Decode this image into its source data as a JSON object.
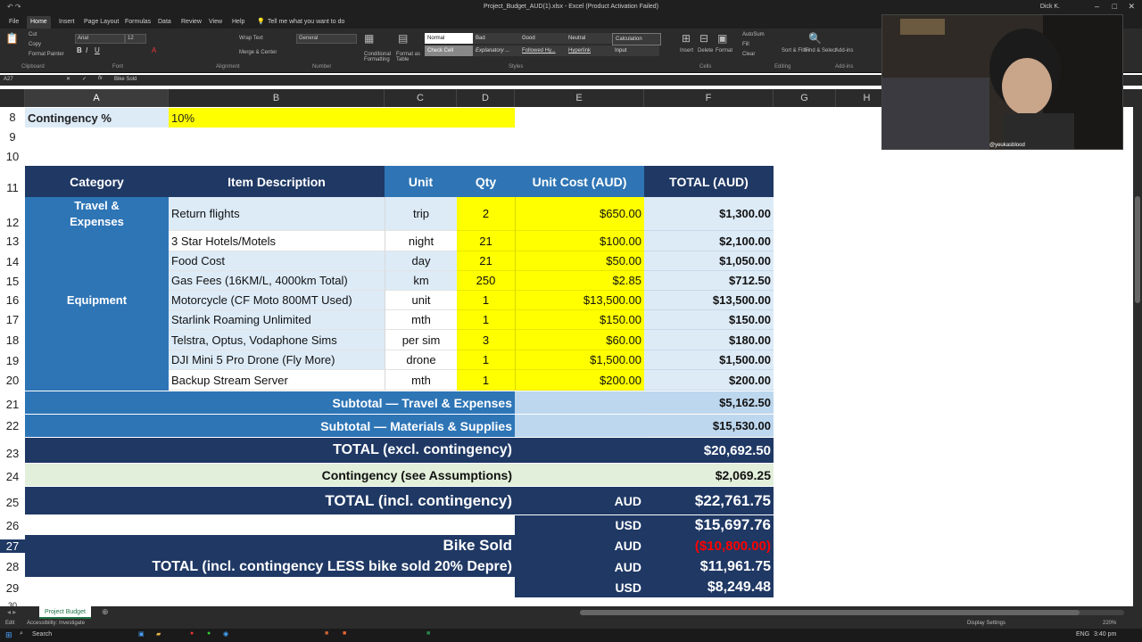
{
  "window": {
    "title": "Project_Budget_AUD(1).xlsx  -  Excel (Product Activation Failed)",
    "user": "Dick K."
  },
  "tabs": [
    "File",
    "Home",
    "Insert",
    "Page Layout",
    "Formulas",
    "Data",
    "Review",
    "View",
    "Help"
  ],
  "tell_me": "Tell me what you want to do",
  "ribbon": {
    "clipboard": {
      "cut": "Cut",
      "copy": "Copy",
      "format_painter": "Format Painter",
      "group": "Clipboard"
    },
    "font": {
      "name": "Arial",
      "size": "12",
      "group": "Font"
    },
    "alignment": {
      "wrap": "Wrap Text",
      "merge": "Merge & Center",
      "group": "Alignment"
    },
    "number": {
      "format": "General",
      "group": "Number"
    },
    "styles": {
      "conditional": "Conditional Formatting",
      "format_table": "Format as Table",
      "cells": [
        "Normal",
        "Bad",
        "Good",
        "Neutral",
        "Calculation",
        "Check Cell",
        "Explanatory ...",
        "Followed Hy...",
        "Hyperlink",
        "Input"
      ],
      "group": "Styles"
    },
    "cells_group": {
      "insert": "Insert",
      "delete": "Delete",
      "format": "Format",
      "group": "Cells"
    },
    "editing": {
      "autosum": "AutoSum",
      "fill": "Fill",
      "clear": "Clear",
      "sort": "Sort & Filter",
      "find": "Find & Select",
      "group": "Editing"
    },
    "addins": {
      "label": "Add-ins",
      "group": "Add-ins"
    }
  },
  "formula_bar": {
    "cell_ref": "A27",
    "content": "Bike Sold"
  },
  "columns": [
    "A",
    "B",
    "C",
    "D",
    "E",
    "F",
    "G",
    "H"
  ],
  "rows": [
    "8",
    "9",
    "10",
    "11",
    "12",
    "13",
    "14",
    "15",
    "16",
    "17",
    "18",
    "19",
    "20",
    "21",
    "22",
    "23",
    "24",
    "25",
    "26",
    "27",
    "28",
    "29",
    "30"
  ],
  "contingency": {
    "label": "Contingency %",
    "value": "10%"
  },
  "headers": {
    "category": "Category",
    "item": "Item Description",
    "unit": "Unit",
    "qty": "Qty",
    "unit_cost": "Unit Cost (AUD)",
    "total": "TOTAL (AUD)"
  },
  "categories": {
    "travel": "Travel & Expenses",
    "equipment": "Equipment"
  },
  "items": [
    {
      "desc": "Return flights",
      "unit": "trip",
      "qty": "2",
      "cost": "$650.00",
      "total": "$1,300.00"
    },
    {
      "desc": "3 Star Hotels/Motels",
      "unit": "night",
      "qty": "21",
      "cost": "$100.00",
      "total": "$2,100.00"
    },
    {
      "desc": "Food Cost",
      "unit": "day",
      "qty": "21",
      "cost": "$50.00",
      "total": "$1,050.00"
    },
    {
      "desc": "Gas Fees (16KM/L, 4000km Total)",
      "unit": "km",
      "qty": "250",
      "cost": "$2.85",
      "total": "$712.50"
    },
    {
      "desc": "Motorcycle (CF Moto 800MT Used)",
      "unit": "unit",
      "qty": "1",
      "cost": "$13,500.00",
      "total": "$13,500.00"
    },
    {
      "desc": "Starlink Roaming Unlimited",
      "unit": "mth",
      "qty": "1",
      "cost": "$150.00",
      "total": "$150.00"
    },
    {
      "desc": "Telstra, Optus, Vodaphone Sims",
      "unit": "per sim",
      "qty": "3",
      "cost": "$60.00",
      "total": "$180.00"
    },
    {
      "desc": "DJI Mini 5 Pro Drone (Fly More)",
      "unit": "drone",
      "qty": "1",
      "cost": "$1,500.00",
      "total": "$1,500.00"
    },
    {
      "desc": "Backup Stream Server",
      "unit": "mth",
      "qty": "1",
      "cost": "$200.00",
      "total": "$200.00"
    }
  ],
  "summary": {
    "sub_travel": {
      "label": "Subtotal — Travel & Expenses",
      "value": "$5,162.50"
    },
    "sub_materials": {
      "label": "Subtotal — Materials & Supplies",
      "value": "$15,530.00"
    },
    "total_excl": {
      "label": "TOTAL (excl. contingency)",
      "value": "$20,692.50"
    },
    "contingency": {
      "label": "Contingency (see Assumptions)",
      "value": "$2,069.25"
    },
    "total_incl": {
      "label": "TOTAL (incl. contingency)",
      "cur": "AUD",
      "value": "$22,761.75"
    },
    "total_incl_usd": {
      "cur": "USD",
      "value": "$15,697.76"
    },
    "bike_sold": {
      "label": "Bike Sold",
      "cur": "AUD",
      "value": "($10,800.00)"
    },
    "total_less": {
      "label": "TOTAL (incl. contingency LESS bike sold 20% Depre)",
      "cur": "AUD",
      "value": "$11,961.75"
    },
    "total_less_usd": {
      "cur": "USD",
      "value": "$8,249.48"
    }
  },
  "sheet_tab": "Project Budget",
  "status": {
    "ready": "Edit",
    "accessibility": "Accessibility: Investigate",
    "display": "Display Settings",
    "zoom": "220%"
  },
  "taskbar": {
    "search": "Search",
    "time": "3:40 pm",
    "lang": "ENG"
  },
  "webcam": {
    "handle": "@yeukasblood"
  },
  "colors": {
    "navy": "#1f3864",
    "blue": "#2e75b6",
    "light_blue": "#ddebf7",
    "yellow": "#ffff00",
    "green": "#e2efda",
    "red": "#ff0000"
  }
}
